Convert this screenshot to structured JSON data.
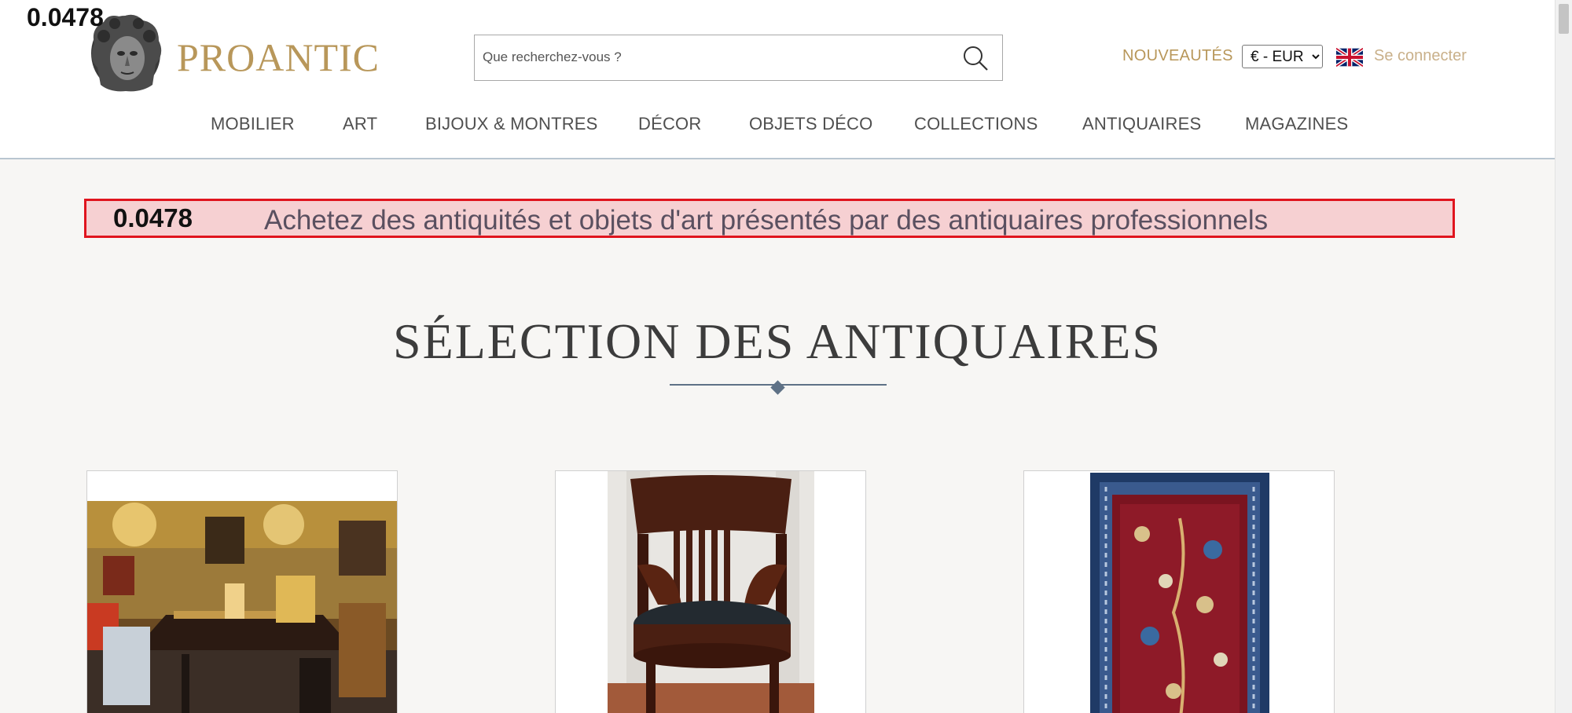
{
  "overlay_score": "0.0478",
  "header": {
    "brand": "PROANTIC",
    "search_placeholder": "Que recherchez-vous ?",
    "nouveautes": "NOUVEAUTÉS",
    "currency": {
      "selected": "€ - EUR",
      "options": [
        "€ - EUR"
      ]
    },
    "login": "Se connecter",
    "nav": [
      "MOBILIER",
      "ART",
      "BIJOUX & MONTRES",
      "DÉCOR",
      "OBJETS DÉCO",
      "COLLECTIONS",
      "ANTIQUAIRES",
      "MAGAZINES"
    ]
  },
  "banner": {
    "score": "0.0478",
    "text": "Achetez des antiquités et objets d'art présentés par des antiquaires professionnels"
  },
  "section_title": "SÉLECTION DES ANTIQUAIRES",
  "cards": [
    {
      "image": "antique-shop-desk-photo"
    },
    {
      "image": "mahogany-armchair-photo"
    },
    {
      "image": "persian-rug-photo"
    }
  ],
  "colors": {
    "gold": "#b8975a",
    "banner_bg": "#f6d0d2",
    "banner_border": "#e0141e",
    "divider": "#5e7186"
  }
}
